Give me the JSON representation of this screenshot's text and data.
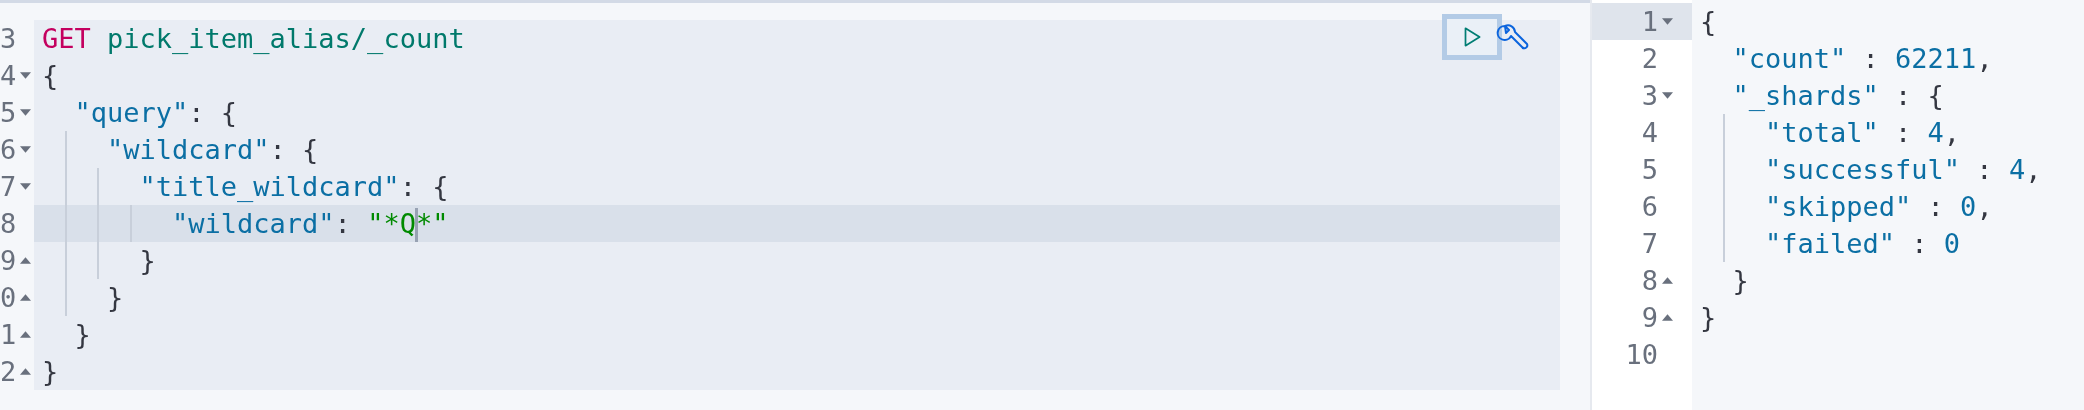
{
  "request_editor": {
    "lines": [
      {
        "number": "3",
        "fold_start": false,
        "fold_end": false,
        "active": false,
        "tokens": [
          {
            "text": "GET",
            "kind": "method"
          },
          {
            "text": " pick_item_alias/_count",
            "kind": "url"
          }
        ]
      },
      {
        "number": "4",
        "fold_start": true,
        "fold_end": false,
        "active": false,
        "tokens": [
          {
            "text": "{",
            "kind": "punct"
          }
        ]
      },
      {
        "number": "5",
        "fold_start": true,
        "fold_end": false,
        "active": false,
        "tokens": [
          {
            "text": "  \"query\"",
            "kind": "key"
          },
          {
            "text": ": {",
            "kind": "punct"
          }
        ]
      },
      {
        "number": "6",
        "fold_start": true,
        "fold_end": false,
        "active": false,
        "tokens": [
          {
            "text": "    \"wildcard\"",
            "kind": "key"
          },
          {
            "text": ": {",
            "kind": "punct"
          }
        ]
      },
      {
        "number": "7",
        "fold_start": true,
        "fold_end": false,
        "active": false,
        "tokens": [
          {
            "text": "      \"title_wildcard\"",
            "kind": "key"
          },
          {
            "text": ": {",
            "kind": "punct"
          }
        ]
      },
      {
        "number": "8",
        "fold_start": false,
        "fold_end": false,
        "active": true,
        "tokens": [
          {
            "text": "        \"wildcard\"",
            "kind": "key"
          },
          {
            "text": ": ",
            "kind": "punct"
          },
          {
            "text": "\"*Q",
            "kind": "string",
            "cursor": true
          },
          {
            "text": "*\"",
            "kind": "string"
          }
        ]
      },
      {
        "number": "9",
        "fold_start": false,
        "fold_end": true,
        "active": false,
        "tokens": [
          {
            "text": "      }",
            "kind": "punct"
          }
        ]
      },
      {
        "number": "0",
        "fold_start": false,
        "fold_end": true,
        "active": false,
        "tokens": [
          {
            "text": "    }",
            "kind": "punct"
          }
        ]
      },
      {
        "number": "1",
        "fold_start": false,
        "fold_end": true,
        "active": false,
        "tokens": [
          {
            "text": "  }",
            "kind": "punct"
          }
        ]
      },
      {
        "number": "2",
        "fold_start": false,
        "fold_end": true,
        "active": false,
        "tokens": [
          {
            "text": "}",
            "kind": "punct"
          }
        ]
      }
    ],
    "run_button": {
      "focused": true
    }
  },
  "response_viewer": {
    "lines": [
      {
        "number": "1",
        "fold_start": true,
        "fold_end": false,
        "active": true,
        "tokens": [
          {
            "text": "{",
            "kind": "punct"
          }
        ]
      },
      {
        "number": "2",
        "fold_start": false,
        "fold_end": false,
        "active": false,
        "tokens": [
          {
            "text": "  \"count\"",
            "kind": "key"
          },
          {
            "text": " : ",
            "kind": "punct"
          },
          {
            "text": "62211",
            "kind": "number"
          },
          {
            "text": ",",
            "kind": "punct"
          }
        ]
      },
      {
        "number": "3",
        "fold_start": true,
        "fold_end": false,
        "active": false,
        "tokens": [
          {
            "text": "  \"_shards\"",
            "kind": "key"
          },
          {
            "text": " : {",
            "kind": "punct"
          }
        ]
      },
      {
        "number": "4",
        "fold_start": false,
        "fold_end": false,
        "active": false,
        "tokens": [
          {
            "text": "    \"total\"",
            "kind": "key"
          },
          {
            "text": " : ",
            "kind": "punct"
          },
          {
            "text": "4",
            "kind": "number"
          },
          {
            "text": ",",
            "kind": "punct"
          }
        ]
      },
      {
        "number": "5",
        "fold_start": false,
        "fold_end": false,
        "active": false,
        "tokens": [
          {
            "text": "    \"successful\"",
            "kind": "key"
          },
          {
            "text": " : ",
            "kind": "punct"
          },
          {
            "text": "4",
            "kind": "number"
          },
          {
            "text": ",",
            "kind": "punct"
          }
        ]
      },
      {
        "number": "6",
        "fold_start": false,
        "fold_end": false,
        "active": false,
        "tokens": [
          {
            "text": "    \"skipped\"",
            "kind": "key"
          },
          {
            "text": " : ",
            "kind": "punct"
          },
          {
            "text": "0",
            "kind": "number"
          },
          {
            "text": ",",
            "kind": "punct"
          }
        ]
      },
      {
        "number": "7",
        "fold_start": false,
        "fold_end": false,
        "active": false,
        "tokens": [
          {
            "text": "    \"failed\"",
            "kind": "key"
          },
          {
            "text": " : ",
            "kind": "punct"
          },
          {
            "text": "0",
            "kind": "number"
          }
        ]
      },
      {
        "number": "8",
        "fold_start": false,
        "fold_end": true,
        "active": false,
        "tokens": [
          {
            "text": "  }",
            "kind": "punct"
          }
        ]
      },
      {
        "number": "9",
        "fold_start": false,
        "fold_end": true,
        "active": false,
        "tokens": [
          {
            "text": "}",
            "kind": "punct"
          }
        ]
      },
      {
        "number": "10",
        "fold_start": false,
        "fold_end": false,
        "active": false
      }
    ]
  }
}
